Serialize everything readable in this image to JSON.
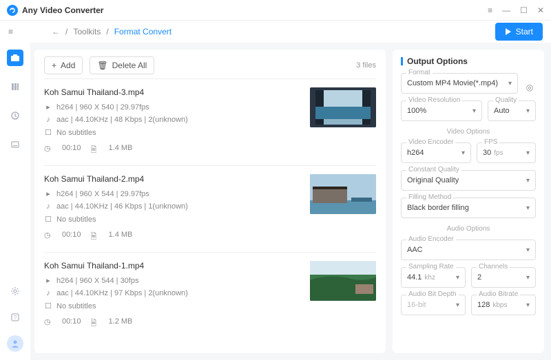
{
  "app": {
    "title": "Any Video Converter"
  },
  "breadcrumb": {
    "root": "Toolkits",
    "current": "Format Convert"
  },
  "actions": {
    "start": "Start",
    "add": "Add",
    "deleteAll": "Delete All"
  },
  "fileCount": "3 files",
  "files": [
    {
      "name": "Koh Samui Thailand-3.mp4",
      "video": "h264 | 960 X 540 | 29.97fps",
      "audio": "aac | 44.10KHz | 48 Kbps | 2(unknown)",
      "subs": "No subtitles",
      "duration": "00:10",
      "size": "1.4 MB"
    },
    {
      "name": "Koh Samui Thailand-2.mp4",
      "video": "h264 | 960 X 544 | 29.97fps",
      "audio": "aac | 44.10KHz | 46 Kbps | 1(unknown)",
      "subs": "No subtitles",
      "duration": "00:10",
      "size": "1.4 MB"
    },
    {
      "name": "Koh Samui Thailand-1.mp4",
      "video": "h264 | 960 X 544 | 30fps",
      "audio": "aac | 44.10KHz | 97 Kbps | 2(unknown)",
      "subs": "No subtitles",
      "duration": "00:10",
      "size": "1.2 MB"
    }
  ],
  "panel": {
    "title": "Output Options",
    "format": {
      "label": "Format",
      "value": "Custom MP4 Movie(*.mp4)"
    },
    "videoSection": "Video Options",
    "audioSection": "Audio Options",
    "resolution": {
      "label": "Video Resolution",
      "value": "100%"
    },
    "quality": {
      "label": "Quality",
      "value": "Auto"
    },
    "encoder": {
      "label": "Video Encoder",
      "value": "h264"
    },
    "fps": {
      "label": "FPS",
      "value": "30",
      "unit": "fps"
    },
    "cq": {
      "label": "Constant Quality",
      "value": "Original Quality"
    },
    "fill": {
      "label": "Filling Method",
      "value": "Black border filling"
    },
    "aencoder": {
      "label": "Audio Encoder",
      "value": "AAC"
    },
    "sample": {
      "label": "Sampling Rate",
      "value": "44.1",
      "unit": "khz"
    },
    "channels": {
      "label": "Channels",
      "value": "2"
    },
    "bitdepth": {
      "label": "Audio Bit Depth",
      "value": "16-bit"
    },
    "abitrate": {
      "label": "Audio Bitrate",
      "value": "128",
      "unit": "kbps"
    }
  }
}
